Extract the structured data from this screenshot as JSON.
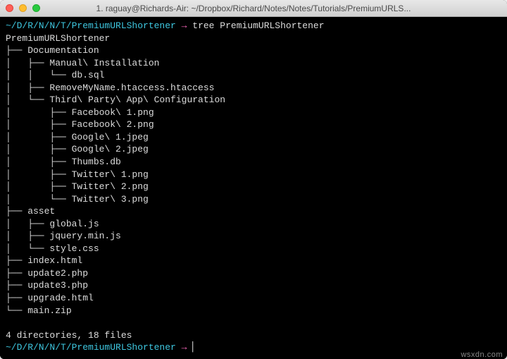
{
  "window": {
    "title": "1. raguay@Richards-Air: ~/Dropbox/Richard/Notes/Notes/Tutorials/PremiumURLS..."
  },
  "prompt1": {
    "path": "~/D/R/N/N/T/PremiumURLShortener",
    "arrow": "→",
    "command": "tree PremiumURLShortener"
  },
  "tree": {
    "l0": "PremiumURLShortener",
    "l1": "├── Documentation",
    "l2": "│   ├── Manual\\ Installation",
    "l3": "│   │   └── db.sql",
    "l4": "│   ├── RemoveMyName.htaccess.htaccess",
    "l5": "│   └── Third\\ Party\\ App\\ Configuration",
    "l6": "│       ├── Facebook\\ 1.png",
    "l7": "│       ├── Facebook\\ 2.png",
    "l8": "│       ├── Google\\ 1.jpeg",
    "l9": "│       ├── Google\\ 2.jpeg",
    "l10": "│       ├── Thumbs.db",
    "l11": "│       ├── Twitter\\ 1.png",
    "l12": "│       ├── Twitter\\ 2.png",
    "l13": "│       └── Twitter\\ 3.png",
    "l14": "├── asset",
    "l15": "│   ├── global.js",
    "l16": "│   ├── jquery.min.js",
    "l17": "│   └── style.css",
    "l18": "├── index.html",
    "l19": "├── update2.php",
    "l20": "├── update3.php",
    "l21": "├── upgrade.html",
    "l22": "└── main.zip"
  },
  "summary": "4 directories, 18 files",
  "prompt2": {
    "path": "~/D/R/N/N/T/PremiumURLShortener",
    "arrow": "→",
    "cursor": "▏"
  },
  "watermark": "wsxdn.com"
}
